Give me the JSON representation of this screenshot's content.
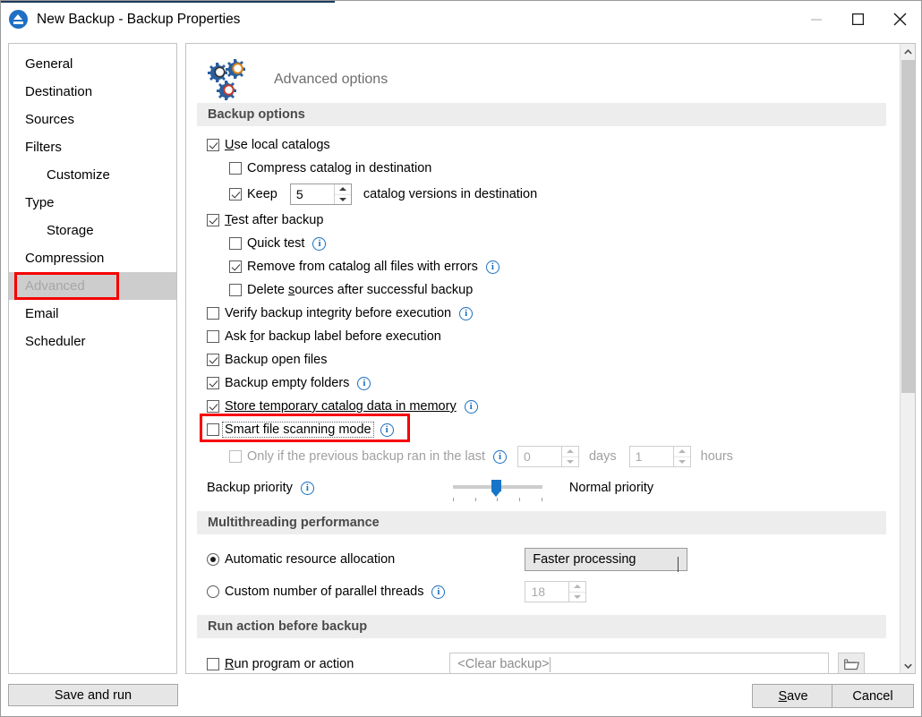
{
  "window": {
    "title": "New Backup - Backup Properties",
    "icon": "app-eject-icon",
    "minimize": "minimize-icon",
    "maximize": "maximize-icon",
    "close": "close-icon"
  },
  "sidebar": {
    "items": [
      {
        "label": "General",
        "sub": false,
        "selected": false
      },
      {
        "label": "Destination",
        "sub": false,
        "selected": false
      },
      {
        "label": "Sources",
        "sub": false,
        "selected": false
      },
      {
        "label": "Filters",
        "sub": false,
        "selected": false
      },
      {
        "label": "Customize",
        "sub": true,
        "selected": false
      },
      {
        "label": "Type",
        "sub": false,
        "selected": false
      },
      {
        "label": "Storage",
        "sub": true,
        "selected": false
      },
      {
        "label": "Compression",
        "sub": false,
        "selected": false
      },
      {
        "label": "Advanced",
        "sub": false,
        "selected": true
      },
      {
        "label": "Email",
        "sub": false,
        "selected": false
      },
      {
        "label": "Scheduler",
        "sub": false,
        "selected": false
      }
    ]
  },
  "panel": {
    "title": "Advanced options",
    "icon": "gears-icon"
  },
  "backup_options": {
    "band": "Backup options",
    "use_local_catalogs": {
      "label": "Use local catalogs",
      "accel": "U",
      "checked": true
    },
    "compress_catalog": {
      "label": "Compress catalog in destination",
      "checked": false
    },
    "keep": {
      "label": "Keep",
      "checked": true,
      "value": "5",
      "suffix": "catalog versions in destination"
    },
    "test_after_backup": {
      "label": "Test after backup",
      "accel": "T",
      "checked": true
    },
    "quick_test": {
      "label": "Quick test",
      "checked": false,
      "info": true
    },
    "remove_from_catalog": {
      "label": "Remove from catalog all files with errors",
      "checked": true,
      "info": true
    },
    "delete_sources": {
      "label": "Delete sources after successful backup",
      "checked": false
    },
    "verify_integrity": {
      "label": "Verify backup integrity before execution",
      "checked": false,
      "info": true
    },
    "ask_label": {
      "label": "Ask for backup label before execution",
      "checked": false
    },
    "backup_open_files": {
      "label": "Backup open files",
      "checked": true
    },
    "backup_empty_folders": {
      "label": "Backup empty folders",
      "checked": true,
      "info": true
    },
    "store_temp_catalog": {
      "label": "Store temporary catalog data in memory",
      "checked": true,
      "info": true
    },
    "smart_file_scanning": {
      "label": "Smart file scanning mode",
      "checked": false,
      "info": true,
      "focused": true,
      "highlighted": true
    },
    "only_if_previous": {
      "label": "Only if the previous backup ran in the last",
      "checked": false,
      "info": true,
      "disabled": true
    },
    "days": {
      "value": "0",
      "unit": "days",
      "disabled": true
    },
    "hours": {
      "value": "1",
      "unit": "hours",
      "disabled": true
    },
    "backup_priority": {
      "label": "Backup priority",
      "info": true,
      "value_label": "Normal priority",
      "slider_position_percent": 48,
      "tick_count": 5
    }
  },
  "multithreading": {
    "band": "Multithreading performance",
    "automatic": {
      "label": "Automatic resource allocation",
      "selected": true
    },
    "custom": {
      "label": "Custom number of parallel threads",
      "selected": false,
      "info": true
    },
    "allocation_mode": {
      "value": "Faster processing",
      "icon": "chevron-down-icon"
    },
    "thread_count": {
      "value": "18",
      "disabled": true
    }
  },
  "run_action": {
    "band": "Run action before backup",
    "run_program": {
      "label": "Run program or action",
      "accel": "R",
      "checked": false
    },
    "program_value": "<Clear backup>",
    "browse_icon": "folder-open-icon"
  },
  "scrollbar": {
    "up_icon": "chevron-up-icon",
    "down_icon": "chevron-down-icon"
  },
  "footer": {
    "save_and_run": "Save and run",
    "save": "Save",
    "cancel": "Cancel"
  },
  "colors": {
    "highlight_red": "#f60000",
    "accent_blue": "#1a6fc0",
    "selected_bg": "#cdcdcd",
    "band_bg": "#ededed"
  }
}
